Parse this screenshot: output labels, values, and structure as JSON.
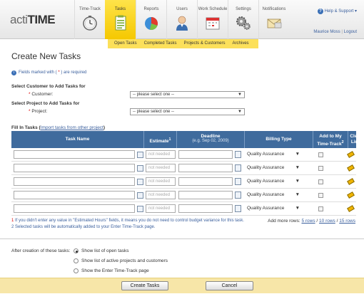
{
  "app": {
    "logo_prefix": "acti",
    "logo_main": "TIME"
  },
  "nav": [
    {
      "label": "Time-Track",
      "icon": "clock-icon"
    },
    {
      "label": "Tasks",
      "icon": "tasks-icon",
      "active": true
    },
    {
      "label": "Reports",
      "icon": "pie-chart-icon"
    },
    {
      "label": "Users",
      "icon": "user-icon"
    },
    {
      "label": "Work Schedule",
      "icon": "calendar-icon"
    },
    {
      "label": "Settings",
      "icon": "gears-icon"
    },
    {
      "label": "Notifications",
      "icon": "envelope-icon"
    }
  ],
  "help": {
    "label": "Help & Support ▾"
  },
  "user": {
    "name": "Maurice Moss",
    "logout": "Logout"
  },
  "subnav": [
    "Open Tasks",
    "Completed Tasks",
    "Projects & Customers",
    "Archives"
  ],
  "page": {
    "title": "Create New Tasks",
    "required_note_a": "Fields marked with (",
    "required_star": " * ",
    "required_note_b": ") are required"
  },
  "customer": {
    "section": "Select Customer to Add Tasks for",
    "label": "Customer:",
    "value": "-- please select one --"
  },
  "project": {
    "section": "Select Project to Add Tasks for",
    "label": "Project:",
    "value": "-- please select one --"
  },
  "fill": {
    "label": "Fill In Tasks",
    "link": "Import tasks from other project"
  },
  "table": {
    "headers": {
      "task_name": "Task Name",
      "estimate": "Estimate",
      "estimate_mark": "1",
      "deadline": "Deadline",
      "deadline_sub": "(e.g. Sep 02, 2009)",
      "billing": "Billing Type",
      "add_to": "Add to My Time-Track",
      "add_to_mark": "2",
      "clear": "Clear Line"
    },
    "rows": [
      {
        "estimate": "not needed",
        "billing": "Quality Assurance"
      },
      {
        "estimate": "not needed",
        "billing": "Quality Assurance"
      },
      {
        "estimate": "not needed",
        "billing": "Quality Assurance"
      },
      {
        "estimate": "not needed",
        "billing": "Quality Assurance"
      },
      {
        "estimate": "not needed",
        "billing": "Quality Assurance"
      }
    ]
  },
  "notes": {
    "note1_mark": "1",
    "note1": " If you didn't enter any value in \"Estimated Hours\" fields, it means you do not need to control budget variance for this task.",
    "note2_mark": "2",
    "note2": " Selected tasks will be automatically added to your Enter Time-Track page."
  },
  "add_rows": {
    "label": "Add more rows:",
    "opt5": "5 rows",
    "opt10": "10 rows",
    "opt15": "15 rows"
  },
  "after": {
    "label": "After creation of these tasks:",
    "options": [
      {
        "label": "Show list of open tasks",
        "selected": true
      },
      {
        "label": "Show list of active projects and customers",
        "selected": false
      },
      {
        "label": "Show the Enter Time-Track page",
        "selected": false
      }
    ]
  },
  "buttons": {
    "create": "Create Tasks",
    "cancel": "Cancel"
  }
}
